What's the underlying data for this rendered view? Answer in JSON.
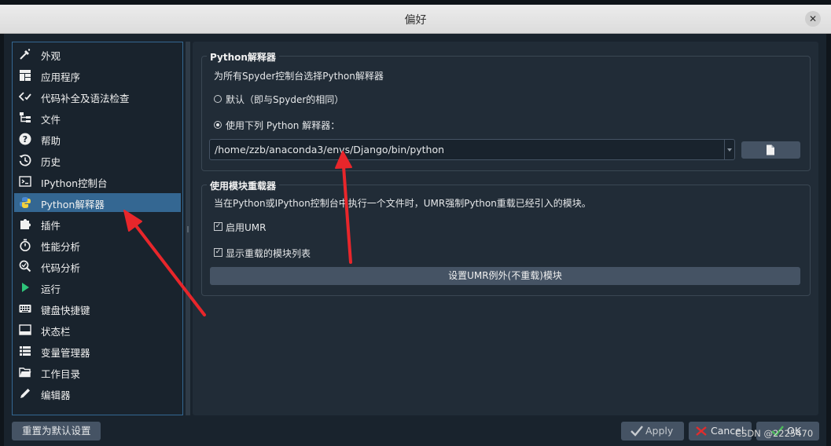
{
  "window": {
    "title": "偏好",
    "close_icon": "close-icon"
  },
  "nav": {
    "selected_index": 7,
    "items": [
      {
        "label": "外观",
        "icon": "paint-brush-icon"
      },
      {
        "label": "应用程序",
        "icon": "layout-icon"
      },
      {
        "label": "代码补全及语法检查",
        "icon": "code-check-icon"
      },
      {
        "label": "文件",
        "icon": "file-tree-icon"
      },
      {
        "label": "帮助",
        "icon": "help-icon"
      },
      {
        "label": "历史",
        "icon": "history-icon"
      },
      {
        "label": "IPython控制台",
        "icon": "terminal-icon"
      },
      {
        "label": "Python解释器",
        "icon": "python-icon"
      },
      {
        "label": "插件",
        "icon": "puzzle-icon"
      },
      {
        "label": "性能分析",
        "icon": "stopwatch-icon"
      },
      {
        "label": "代码分析",
        "icon": "code-analysis-icon"
      },
      {
        "label": "运行",
        "icon": "run-icon"
      },
      {
        "label": "键盘快捷键",
        "icon": "keyboard-icon"
      },
      {
        "label": "状态栏",
        "icon": "status-bar-icon"
      },
      {
        "label": "变量管理器",
        "icon": "variable-explorer-icon"
      },
      {
        "label": "工作目录",
        "icon": "folder-icon"
      },
      {
        "label": "编辑器",
        "icon": "pencil-icon"
      }
    ]
  },
  "interpreter": {
    "group_title": "Python解释器",
    "description": "为所有Spyder控制台选择Python解释器",
    "option_default": "默认（即与Spyder的相同）",
    "option_custom": "使用下列 Python 解释器：",
    "selected_option": "custom",
    "path_value": "/home/zzb/anaconda3/envs/Django/bin/python",
    "browse_icon": "file-icon"
  },
  "umr": {
    "group_title": "使用模块重载器",
    "description": "当在Python或IPython控制台中执行一个文件时，UMR强制Python重载已经引入的模块。",
    "enable_label": "启用UMR",
    "enable_checked": true,
    "show_list_label": "显示重载的模块列表",
    "show_list_checked": true,
    "exclude_button": "设置UMR例外(不重载)模块"
  },
  "footer": {
    "reset_label": "重置为默认设置",
    "apply_label": "Apply",
    "cancel_label": "Cancel",
    "ok_label": "OK"
  },
  "watermark": "CSDN @2225470",
  "colors": {
    "background": "#19232d",
    "panel": "#212c37",
    "selection": "#346792",
    "button": "#455364",
    "annotation_arrow": "#e8262b"
  }
}
